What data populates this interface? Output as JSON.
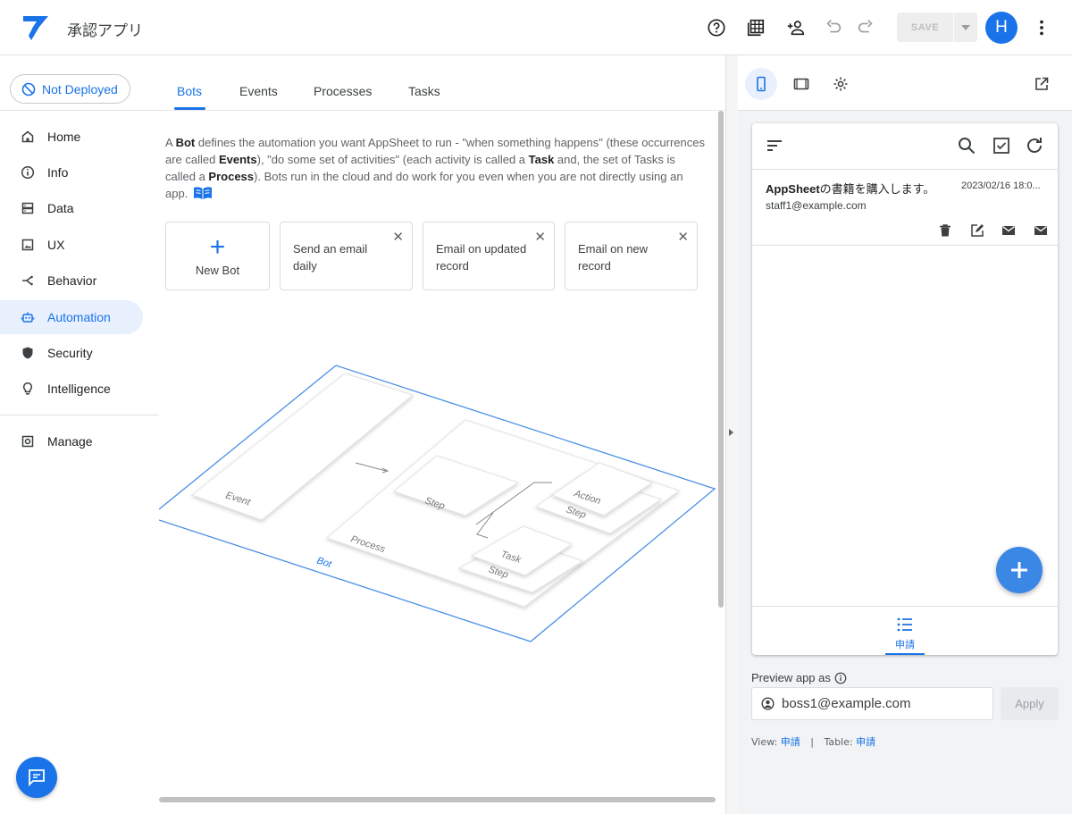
{
  "header": {
    "app_title": "承認アプリ",
    "save_label": "SAVE",
    "avatar_initial": "H",
    "icons": [
      "help-icon",
      "tables-icon",
      "add-person-icon",
      "undo-icon",
      "redo-icon",
      "more-vert-icon"
    ]
  },
  "sidebar": {
    "deploy_status": "Not Deployed",
    "items": [
      {
        "label": "Home",
        "icon": "home-icon"
      },
      {
        "label": "Info",
        "icon": "info-icon"
      },
      {
        "label": "Data",
        "icon": "data-icon"
      },
      {
        "label": "UX",
        "icon": "ux-icon"
      },
      {
        "label": "Behavior",
        "icon": "behavior-icon"
      },
      {
        "label": "Automation",
        "icon": "robot-icon"
      },
      {
        "label": "Security",
        "icon": "shield-icon"
      },
      {
        "label": "Intelligence",
        "icon": "bulb-icon"
      },
      {
        "label": "Manage",
        "icon": "manage-icon"
      }
    ],
    "active": "Automation"
  },
  "main": {
    "tabs": [
      {
        "label": "Bots"
      },
      {
        "label": "Events"
      },
      {
        "label": "Processes"
      },
      {
        "label": "Tasks"
      }
    ],
    "active_tab": "Bots",
    "description": {
      "p1": "A ",
      "b1": "Bot",
      "p2": " defines the automation you want AppSheet to run - \"when something happens\" (these occurrences are called ",
      "b2": "Events",
      "p3": "), \"do some set of activities\" (each activity is called a ",
      "b3": "Task",
      "p4": " and, the set of Tasks is called a ",
      "b4": "Process",
      "p5": "). Bots run in the cloud and do work for you even when you are not directly using an app."
    },
    "new_bot_label": "New Bot",
    "bots": [
      {
        "name": "Send an email daily"
      },
      {
        "name": "Email on updated record"
      },
      {
        "name": "Email on new record"
      }
    ],
    "diagram": {
      "event": "Event",
      "process": "Process",
      "step1": "Step",
      "action": "Action",
      "step2": "Step",
      "task": "Task",
      "step3": "Step",
      "bot": "Bot"
    }
  },
  "preview": {
    "record": {
      "title_prefix": "AppSheet",
      "title_rest": "の書籍を購入します。",
      "date": "2023/02/16 18:0...",
      "email": "staff1@example.com"
    },
    "nav_label": "申請",
    "preview_as_label": "Preview app as",
    "preview_as_value": "boss1@example.com",
    "apply_label": "Apply",
    "view_label": "View:",
    "view_value": "申請",
    "table_label": "Table:",
    "table_value": "申請",
    "separator": "|"
  },
  "colors": {
    "accent": "#1a73e8",
    "active_bg": "#e8f0fe",
    "fab": "#3b87e5"
  }
}
